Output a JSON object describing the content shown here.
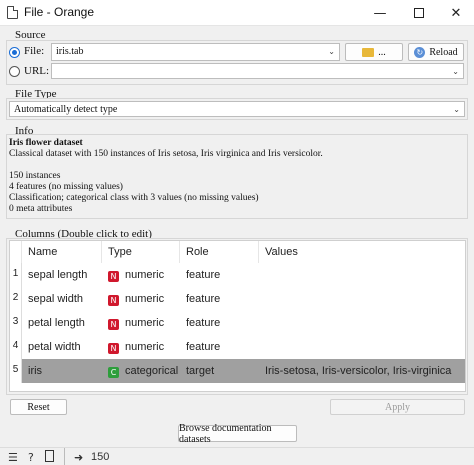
{
  "window": {
    "title": "File - Orange"
  },
  "source": {
    "label": "Source",
    "file_label": "File:",
    "file_value": "iris.tab",
    "browse_label": "...",
    "reload_label": "Reload",
    "url_label": "URL:",
    "url_value": ""
  },
  "file_type": {
    "label": "File Type",
    "value": "Automatically detect type"
  },
  "info": {
    "label": "Info",
    "title": "Iris flower dataset",
    "lines": [
      "Classical dataset with 150 instances of Iris setosa, Iris virginica and Iris versicolor.",
      "",
      "150 instances",
      "4 features (no missing values)",
      "Classification; categorical class with 3 values (no missing values)",
      "0 meta attributes"
    ]
  },
  "columns": {
    "label": "Columns (Double click to edit)",
    "headers": [
      "Name",
      "Type",
      "Role",
      "Values"
    ],
    "rows": [
      {
        "num": "1",
        "name": "sepal length",
        "badge": "N",
        "type": "numeric",
        "role": "feature",
        "values": ""
      },
      {
        "num": "2",
        "name": "sepal width",
        "badge": "N",
        "type": "numeric",
        "role": "feature",
        "values": ""
      },
      {
        "num": "3",
        "name": "petal length",
        "badge": "N",
        "type": "numeric",
        "role": "feature",
        "values": ""
      },
      {
        "num": "4",
        "name": "petal width",
        "badge": "N",
        "type": "numeric",
        "role": "feature",
        "values": ""
      },
      {
        "num": "5",
        "name": "iris",
        "badge": "C",
        "type": "categorical",
        "role": "target",
        "values": "Iris-setosa, Iris-versicolor, Iris-virginica"
      }
    ]
  },
  "buttons": {
    "reset": "Reset",
    "apply": "Apply",
    "browse_docs": "Browse documentation datasets"
  },
  "status": {
    "count": "150"
  },
  "colors": {
    "numeric_badge": "#d0182d",
    "categorical_badge": "#2e9e3c",
    "accent": "#1a6dd6",
    "selected_row": "#a0a0a0"
  },
  "icons": [
    "minimize-icon",
    "maximize-icon",
    "close-icon",
    "folder-icon",
    "reload-icon",
    "help-icon",
    "report-icon",
    "output-icon"
  ]
}
